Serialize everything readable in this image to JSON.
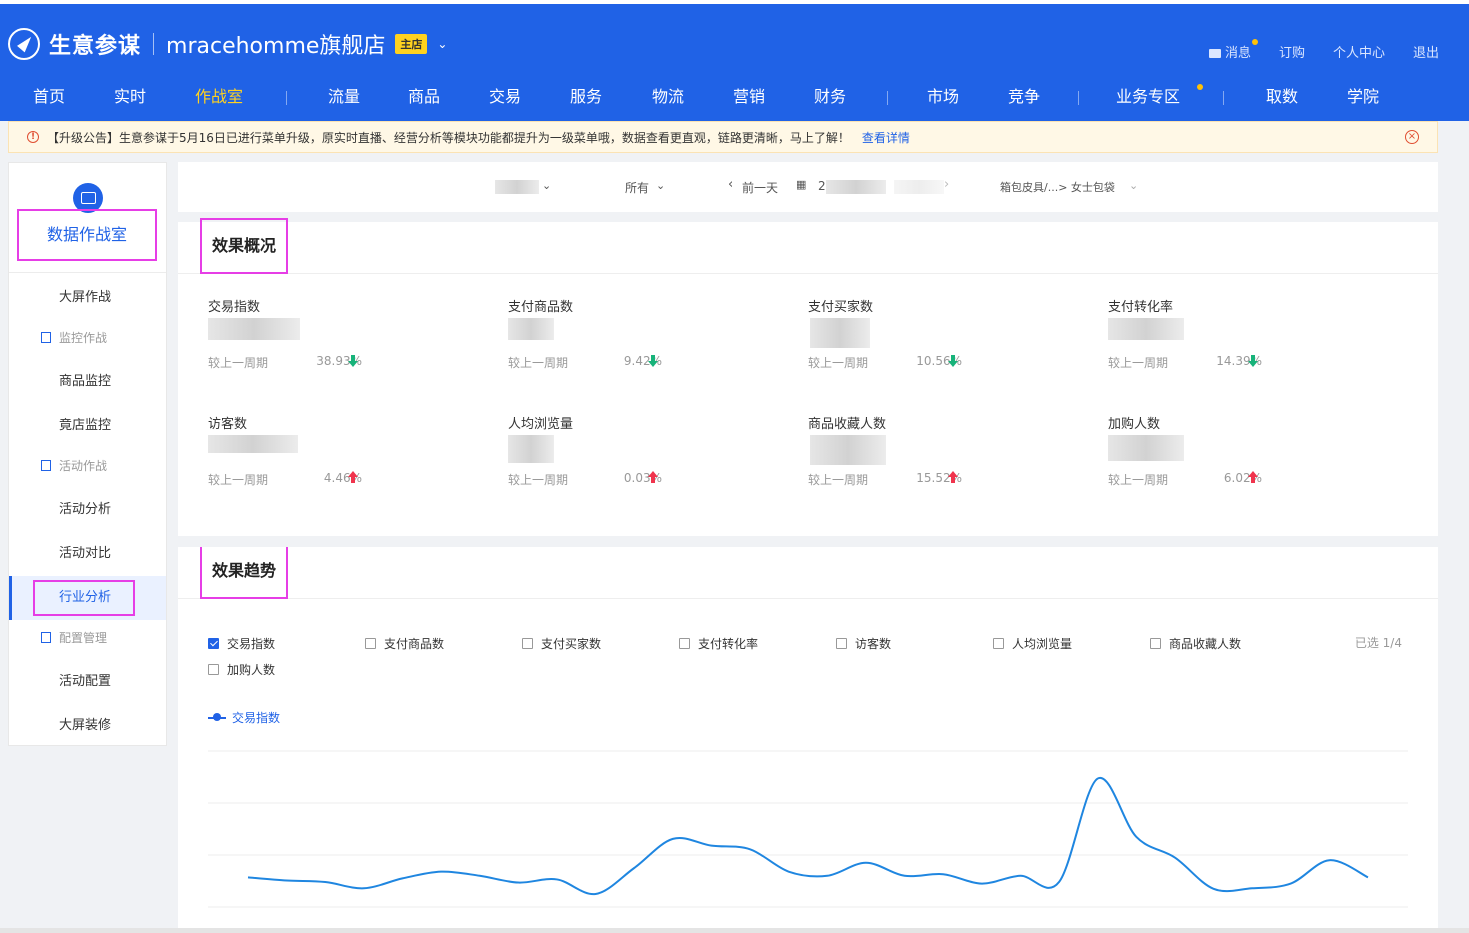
{
  "brand": {
    "name": "生意参谋",
    "shop": "mracehomme旗舰店",
    "shop_badge": "主店"
  },
  "top_links": [
    "消息",
    "订购",
    "个人中心",
    "退出"
  ],
  "nav": {
    "items": [
      "首页",
      "实时",
      "作战室",
      "流量",
      "商品",
      "交易",
      "服务",
      "物流",
      "营销",
      "财务",
      "市场",
      "竞争",
      "业务专区",
      "取数",
      "学院"
    ],
    "active": "作战室"
  },
  "notice": {
    "text": "【升级公告】生意参谋于5月16日已进行菜单升级，原实时直播、经营分析等模块功能都提升为一级菜单哦，数据查看更直观，链路更清晰，马上了解！",
    "link": "查看详情"
  },
  "sidebar": {
    "title": "数据作战室",
    "items": [
      {
        "type": "item",
        "label": "大屏作战"
      },
      {
        "type": "group",
        "label": "监控作战"
      },
      {
        "type": "item",
        "label": "商品监控"
      },
      {
        "type": "item",
        "label": "竟店监控"
      },
      {
        "type": "group",
        "label": "活动作战"
      },
      {
        "type": "item",
        "label": "活动分析"
      },
      {
        "type": "item",
        "label": "活动对比"
      },
      {
        "type": "item",
        "label": "行业分析",
        "active": true
      },
      {
        "type": "group",
        "label": "配置管理"
      },
      {
        "type": "item",
        "label": "活动配置"
      },
      {
        "type": "item",
        "label": "大屏装修"
      }
    ]
  },
  "filters": {
    "terminal": "所有",
    "prev_day": "前一天",
    "date_prefix": "2",
    "category": "箱包皮具/...> 女士包袋"
  },
  "overview": {
    "title": "效果概况",
    "compare_label": "较上一周期",
    "metrics": [
      {
        "label": "交易指数",
        "pct": "38.93%",
        "trend": "down"
      },
      {
        "label": "支付商品数",
        "pct": "9.42%",
        "trend": "down"
      },
      {
        "label": "支付买家数",
        "pct": "10.56%",
        "trend": "down"
      },
      {
        "label": "支付转化率",
        "pct": "14.39%",
        "trend": "down"
      },
      {
        "label": "访客数",
        "pct": "4.46%",
        "trend": "up"
      },
      {
        "label": "人均浏览量",
        "pct": "0.03%",
        "trend": "up"
      },
      {
        "label": "商品收藏人数",
        "pct": "15.52%",
        "trend": "up"
      },
      {
        "label": "加购人数",
        "pct": "6.02%",
        "trend": "up"
      }
    ]
  },
  "trend": {
    "title": "效果趋势",
    "checkboxes": [
      {
        "label": "交易指数",
        "checked": true
      },
      {
        "label": "支付商品数",
        "checked": false
      },
      {
        "label": "支付买家数",
        "checked": false
      },
      {
        "label": "支付转化率",
        "checked": false
      },
      {
        "label": "访客数",
        "checked": false
      },
      {
        "label": "人均浏览量",
        "checked": false
      },
      {
        "label": "商品收藏人数",
        "checked": false
      },
      {
        "label": "加购人数",
        "checked": false
      }
    ],
    "selected_count": "已选 1/4",
    "legend": "交易指数",
    "colors": {
      "line": "#1f86e0",
      "accent": "#2062e6"
    }
  },
  "chart_data": {
    "type": "line",
    "series": [
      {
        "name": "交易指数",
        "values": [
          0.57,
          0.51,
          0.48,
          0.36,
          0.55,
          0.68,
          0.6,
          0.47,
          0.53,
          0.25,
          0.75,
          1.31,
          1.18,
          1.11,
          0.68,
          0.6,
          0.85,
          0.6,
          0.63,
          0.45,
          0.6,
          0.48,
          2.47,
          1.35,
          0.95,
          0.35,
          0.36,
          0.45,
          0.9,
          0.57
        ]
      }
    ],
    "ylim": [
      0,
      3
    ],
    "grid": true,
    "legend_position": "top-left"
  }
}
